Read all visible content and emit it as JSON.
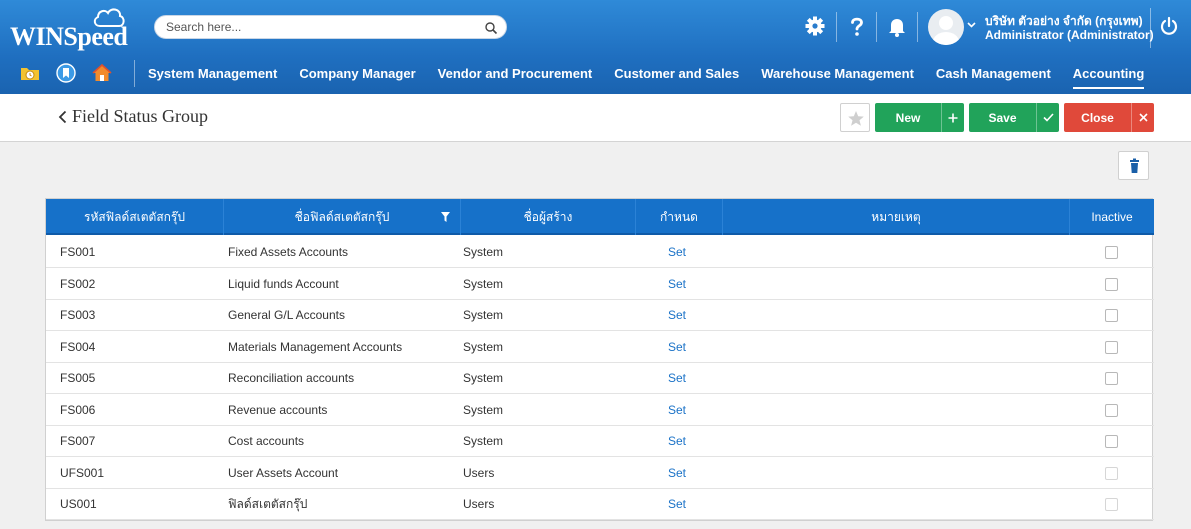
{
  "app": {
    "logo_text": "WINSpeed",
    "search_placeholder": "Search here...",
    "company": "บริษัท ตัวอย่าง จำกัด (กรุงเทพ)",
    "user": "Administrator (Administrator)",
    "top_icons": [
      "gear-icon",
      "help-icon",
      "bell-icon"
    ],
    "quick_icons": [
      "folder-clock-icon",
      "bookmark-icon",
      "home-icon"
    ]
  },
  "nav": {
    "items": [
      {
        "label": "System Management"
      },
      {
        "label": "Company Manager"
      },
      {
        "label": "Vendor and Procurement"
      },
      {
        "label": "Customer and Sales"
      },
      {
        "label": "Warehouse Management"
      },
      {
        "label": "Cash Management"
      },
      {
        "label": "Accounting"
      }
    ],
    "active_index": 6
  },
  "page": {
    "title": "Field Status Group"
  },
  "toolbar": {
    "new_label": "New",
    "save_label": "Save",
    "close_label": "Close"
  },
  "colors": {
    "header_blue": "#1f6fc0",
    "table_header": "#1671c9",
    "green": "#21a35a",
    "red": "#e0493a",
    "link": "#1a72c7"
  },
  "table": {
    "columns": [
      {
        "label": "รหัสฟิลด์สเตตัสกรุ๊ป"
      },
      {
        "label": "ชื่อฟิลด์สเตตัสกรุ๊ป"
      },
      {
        "label": "ชื่อผู้สร้าง"
      },
      {
        "label": "กำหนด"
      },
      {
        "label": "หมายเหตุ"
      },
      {
        "label": "Inactive"
      }
    ],
    "rows": [
      {
        "code": "FS001",
        "name": "Fixed Assets Accounts",
        "creator": "System",
        "action": "Set",
        "note": "",
        "inactive": false
      },
      {
        "code": "FS002",
        "name": "Liquid funds Account",
        "creator": "System",
        "action": "Set",
        "note": "",
        "inactive": false
      },
      {
        "code": "FS003",
        "name": "General G/L Accounts",
        "creator": "System",
        "action": "Set",
        "note": "",
        "inactive": false
      },
      {
        "code": "FS004",
        "name": "Materials Management Accounts",
        "creator": "System",
        "action": "Set",
        "note": "",
        "inactive": false
      },
      {
        "code": "FS005",
        "name": "Reconciliation accounts",
        "creator": "System",
        "action": "Set",
        "note": "",
        "inactive": false
      },
      {
        "code": "FS006",
        "name": "Revenue accounts",
        "creator": "System",
        "action": "Set",
        "note": "",
        "inactive": false
      },
      {
        "code": "FS007",
        "name": "Cost accounts",
        "creator": "System",
        "action": "Set",
        "note": "",
        "inactive": false
      },
      {
        "code": "UFS001",
        "name": "User Assets Account",
        "creator": "Users",
        "action": "Set",
        "note": "",
        "inactive": false
      },
      {
        "code": "US001",
        "name": "ฟิลด์สเตตัสกรุ๊ป",
        "creator": "Users",
        "action": "Set",
        "note": "",
        "inactive": false
      }
    ]
  }
}
